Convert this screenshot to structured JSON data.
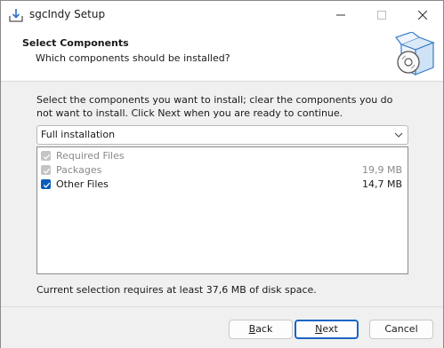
{
  "window": {
    "title": "sgcIndy Setup",
    "icons": {
      "app": "installer-icon",
      "minimize": "minimize-icon",
      "maximize": "maximize-icon",
      "close": "close-icon"
    }
  },
  "header": {
    "title": "Select Components",
    "subtitle": "Which components should be installed?",
    "image": "box-with-disc-icon"
  },
  "body": {
    "description": "Select the components you want to install; clear the components you do not want to install. Click Next when you are ready to continue.",
    "install_type": {
      "selected": "Full installation",
      "icon": "chevron-down-icon"
    },
    "components": [
      {
        "label": "Required Files",
        "size": "",
        "checked": true,
        "enabled": false
      },
      {
        "label": "Packages",
        "size": "19,9 MB",
        "checked": true,
        "enabled": false
      },
      {
        "label": "Other Files",
        "size": "14,7 MB",
        "checked": true,
        "enabled": true
      }
    ],
    "space_required": "Current selection requires at least 37,6 MB of disk space."
  },
  "buttons": {
    "back": {
      "accel": "B",
      "rest": "ack"
    },
    "next": {
      "accel": "N",
      "rest": "ext"
    },
    "cancel": "Cancel"
  },
  "colors": {
    "accent": "#0b5cba",
    "disabled_check": "#c4c4c4",
    "default_button_border": "#1c64c4"
  }
}
